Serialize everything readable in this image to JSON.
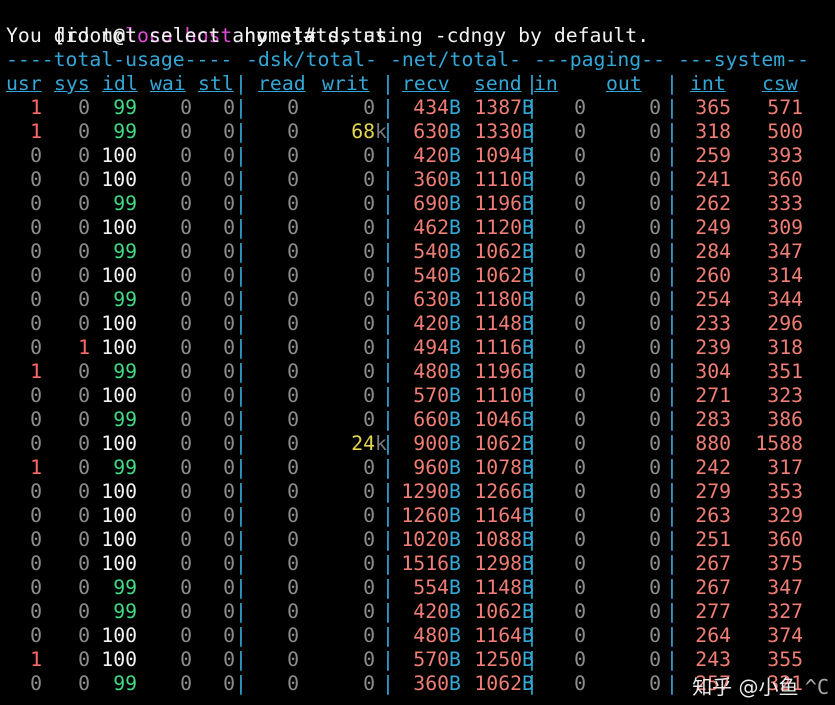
{
  "prompt": {
    "user": "[root@",
    "host": "localhost",
    "rest": " home]# ",
    "command": "dstat"
  },
  "notice": "You did not select any stats, using -cdngy by default.",
  "group_headers": [
    "----total-usage----",
    "-dsk/total-",
    "-net/total-",
    "---paging--",
    "---system--"
  ],
  "columns": [
    "usr",
    "sys",
    "idl",
    "wai",
    "stl",
    "read",
    "writ",
    "recv",
    "send",
    "in",
    "out",
    "int",
    "csw"
  ],
  "rows": [
    {
      "usr": "1",
      "sys": "0",
      "idl": "99",
      "wai": "0",
      "stl": "0",
      "read": "0",
      "writ": "0",
      "writ_unit": "",
      "recv": "434",
      "recv_unit": "B",
      "send": "1387",
      "send_unit": "B",
      "in": "0",
      "out": "0",
      "int": "365",
      "csw": "571"
    },
    {
      "usr": "1",
      "sys": "0",
      "idl": "99",
      "wai": "0",
      "stl": "0",
      "read": "0",
      "writ": "68",
      "writ_unit": "k",
      "recv": "630",
      "recv_unit": "B",
      "send": "1330",
      "send_unit": "B",
      "in": "0",
      "out": "0",
      "int": "318",
      "csw": "500"
    },
    {
      "usr": "0",
      "sys": "0",
      "idl": "100",
      "wai": "0",
      "stl": "0",
      "read": "0",
      "writ": "0",
      "writ_unit": "",
      "recv": "420",
      "recv_unit": "B",
      "send": "1094",
      "send_unit": "B",
      "in": "0",
      "out": "0",
      "int": "259",
      "csw": "393"
    },
    {
      "usr": "0",
      "sys": "0",
      "idl": "100",
      "wai": "0",
      "stl": "0",
      "read": "0",
      "writ": "0",
      "writ_unit": "",
      "recv": "360",
      "recv_unit": "B",
      "send": "1110",
      "send_unit": "B",
      "in": "0",
      "out": "0",
      "int": "241",
      "csw": "360"
    },
    {
      "usr": "0",
      "sys": "0",
      "idl": "99",
      "wai": "0",
      "stl": "0",
      "read": "0",
      "writ": "0",
      "writ_unit": "",
      "recv": "690",
      "recv_unit": "B",
      "send": "1196",
      "send_unit": "B",
      "in": "0",
      "out": "0",
      "int": "262",
      "csw": "333"
    },
    {
      "usr": "0",
      "sys": "0",
      "idl": "100",
      "wai": "0",
      "stl": "0",
      "read": "0",
      "writ": "0",
      "writ_unit": "",
      "recv": "462",
      "recv_unit": "B",
      "send": "1120",
      "send_unit": "B",
      "in": "0",
      "out": "0",
      "int": "249",
      "csw": "309"
    },
    {
      "usr": "0",
      "sys": "0",
      "idl": "99",
      "wai": "0",
      "stl": "0",
      "read": "0",
      "writ": "0",
      "writ_unit": "",
      "recv": "540",
      "recv_unit": "B",
      "send": "1062",
      "send_unit": "B",
      "in": "0",
      "out": "0",
      "int": "284",
      "csw": "347"
    },
    {
      "usr": "0",
      "sys": "0",
      "idl": "100",
      "wai": "0",
      "stl": "0",
      "read": "0",
      "writ": "0",
      "writ_unit": "",
      "recv": "540",
      "recv_unit": "B",
      "send": "1062",
      "send_unit": "B",
      "in": "0",
      "out": "0",
      "int": "260",
      "csw": "314"
    },
    {
      "usr": "0",
      "sys": "0",
      "idl": "99",
      "wai": "0",
      "stl": "0",
      "read": "0",
      "writ": "0",
      "writ_unit": "",
      "recv": "630",
      "recv_unit": "B",
      "send": "1180",
      "send_unit": "B",
      "in": "0",
      "out": "0",
      "int": "254",
      "csw": "344"
    },
    {
      "usr": "0",
      "sys": "0",
      "idl": "100",
      "wai": "0",
      "stl": "0",
      "read": "0",
      "writ": "0",
      "writ_unit": "",
      "recv": "420",
      "recv_unit": "B",
      "send": "1148",
      "send_unit": "B",
      "in": "0",
      "out": "0",
      "int": "233",
      "csw": "296"
    },
    {
      "usr": "0",
      "sys": "1",
      "idl": "100",
      "wai": "0",
      "stl": "0",
      "read": "0",
      "writ": "0",
      "writ_unit": "",
      "recv": "494",
      "recv_unit": "B",
      "send": "1116",
      "send_unit": "B",
      "in": "0",
      "out": "0",
      "int": "239",
      "csw": "318"
    },
    {
      "usr": "1",
      "sys": "0",
      "idl": "99",
      "wai": "0",
      "stl": "0",
      "read": "0",
      "writ": "0",
      "writ_unit": "",
      "recv": "480",
      "recv_unit": "B",
      "send": "1196",
      "send_unit": "B",
      "in": "0",
      "out": "0",
      "int": "304",
      "csw": "351"
    },
    {
      "usr": "0",
      "sys": "0",
      "idl": "100",
      "wai": "0",
      "stl": "0",
      "read": "0",
      "writ": "0",
      "writ_unit": "",
      "recv": "570",
      "recv_unit": "B",
      "send": "1110",
      "send_unit": "B",
      "in": "0",
      "out": "0",
      "int": "271",
      "csw": "323"
    },
    {
      "usr": "0",
      "sys": "0",
      "idl": "99",
      "wai": "0",
      "stl": "0",
      "read": "0",
      "writ": "0",
      "writ_unit": "",
      "recv": "660",
      "recv_unit": "B",
      "send": "1046",
      "send_unit": "B",
      "in": "0",
      "out": "0",
      "int": "283",
      "csw": "386"
    },
    {
      "usr": "0",
      "sys": "0",
      "idl": "100",
      "wai": "0",
      "stl": "0",
      "read": "0",
      "writ": "24",
      "writ_unit": "k",
      "recv": "900",
      "recv_unit": "B",
      "send": "1062",
      "send_unit": "B",
      "in": "0",
      "out": "0",
      "int": "880",
      "csw": "1588"
    },
    {
      "usr": "1",
      "sys": "0",
      "idl": "99",
      "wai": "0",
      "stl": "0",
      "read": "0",
      "writ": "0",
      "writ_unit": "",
      "recv": "960",
      "recv_unit": "B",
      "send": "1078",
      "send_unit": "B",
      "in": "0",
      "out": "0",
      "int": "242",
      "csw": "317"
    },
    {
      "usr": "0",
      "sys": "0",
      "idl": "100",
      "wai": "0",
      "stl": "0",
      "read": "0",
      "writ": "0",
      "writ_unit": "",
      "recv": "1290",
      "recv_unit": "B",
      "send": "1266",
      "send_unit": "B",
      "in": "0",
      "out": "0",
      "int": "279",
      "csw": "353"
    },
    {
      "usr": "0",
      "sys": "0",
      "idl": "100",
      "wai": "0",
      "stl": "0",
      "read": "0",
      "writ": "0",
      "writ_unit": "",
      "recv": "1260",
      "recv_unit": "B",
      "send": "1164",
      "send_unit": "B",
      "in": "0",
      "out": "0",
      "int": "263",
      "csw": "329"
    },
    {
      "usr": "0",
      "sys": "0",
      "idl": "100",
      "wai": "0",
      "stl": "0",
      "read": "0",
      "writ": "0",
      "writ_unit": "",
      "recv": "1020",
      "recv_unit": "B",
      "send": "1088",
      "send_unit": "B",
      "in": "0",
      "out": "0",
      "int": "251",
      "csw": "360"
    },
    {
      "usr": "0",
      "sys": "0",
      "idl": "100",
      "wai": "0",
      "stl": "0",
      "read": "0",
      "writ": "0",
      "writ_unit": "",
      "recv": "1516",
      "recv_unit": "B",
      "send": "1298",
      "send_unit": "B",
      "in": "0",
      "out": "0",
      "int": "267",
      "csw": "375"
    },
    {
      "usr": "0",
      "sys": "0",
      "idl": "99",
      "wai": "0",
      "stl": "0",
      "read": "0",
      "writ": "0",
      "writ_unit": "",
      "recv": "554",
      "recv_unit": "B",
      "send": "1148",
      "send_unit": "B",
      "in": "0",
      "out": "0",
      "int": "267",
      "csw": "347"
    },
    {
      "usr": "0",
      "sys": "0",
      "idl": "99",
      "wai": "0",
      "stl": "0",
      "read": "0",
      "writ": "0",
      "writ_unit": "",
      "recv": "420",
      "recv_unit": "B",
      "send": "1062",
      "send_unit": "B",
      "in": "0",
      "out": "0",
      "int": "277",
      "csw": "327"
    },
    {
      "usr": "0",
      "sys": "0",
      "idl": "100",
      "wai": "0",
      "stl": "0",
      "read": "0",
      "writ": "0",
      "writ_unit": "",
      "recv": "480",
      "recv_unit": "B",
      "send": "1164",
      "send_unit": "B",
      "in": "0",
      "out": "0",
      "int": "264",
      "csw": "374"
    },
    {
      "usr": "1",
      "sys": "0",
      "idl": "100",
      "wai": "0",
      "stl": "0",
      "read": "0",
      "writ": "0",
      "writ_unit": "",
      "recv": "570",
      "recv_unit": "B",
      "send": "1250",
      "send_unit": "B",
      "in": "0",
      "out": "0",
      "int": "243",
      "csw": "355"
    },
    {
      "usr": "0",
      "sys": "0",
      "idl": "99",
      "wai": "0",
      "stl": "0",
      "read": "0",
      "writ": "0",
      "writ_unit": "",
      "recv": "360",
      "recv_unit": "B",
      "send": "1062",
      "send_unit": "B",
      "in": "0",
      "out": "0",
      "int": "257",
      "csw": "321"
    }
  ],
  "watermark": "知乎 @小鱼",
  "trailing": "^C",
  "colors": {
    "header": "#33a7d6",
    "prompt_host": "#e04bd8",
    "low_zero": "#8c8c8c",
    "usr_sys_active": "#ff6b6b",
    "idle_99": "#3ddc84",
    "idle_100": "#f2f2f2",
    "system_vals": "#f07e74",
    "writ_nonzero": "#e6d84a"
  }
}
